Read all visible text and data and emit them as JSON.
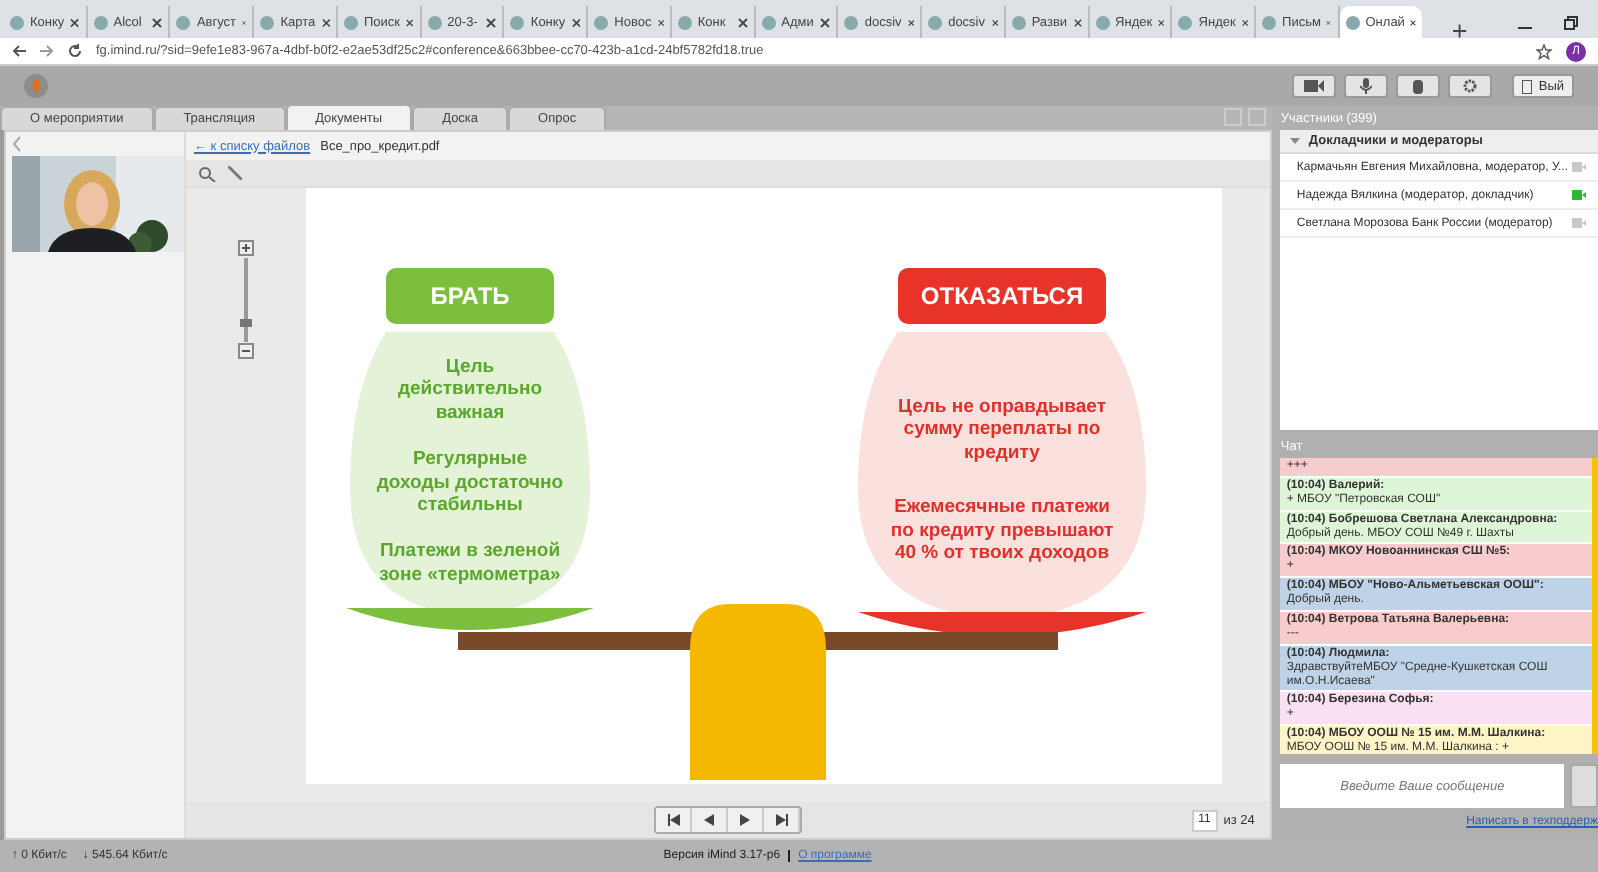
{
  "browser": {
    "tabs": [
      {
        "title": "Конку",
        "selected": false
      },
      {
        "title": "Alcol",
        "selected": false
      },
      {
        "title": "Август",
        "selected": false
      },
      {
        "title": "Карта",
        "selected": false
      },
      {
        "title": "Поиск",
        "selected": false
      },
      {
        "title": "20-3-",
        "selected": false
      },
      {
        "title": "Конку",
        "selected": false
      },
      {
        "title": "Новос",
        "selected": false
      },
      {
        "title": "Конк",
        "selected": false
      },
      {
        "title": "Адми",
        "selected": false
      },
      {
        "title": "docsiv",
        "selected": false
      },
      {
        "title": "docsiv",
        "selected": false
      },
      {
        "title": "Разви",
        "selected": false
      },
      {
        "title": "Яндек",
        "selected": false
      },
      {
        "title": "Яндек",
        "selected": false
      },
      {
        "title": "Письм",
        "selected": false
      },
      {
        "title": "Онлай",
        "selected": true
      }
    ],
    "url": "fg.imind.ru/?sid=9efe1e83-967a-4dbf-b0f2-e2ae53df25c2#conference&663bbee-cc70-423b-a1cd-24bf5782fd18.true",
    "profile_initial": "Л"
  },
  "header": {
    "exit_label": "Вый"
  },
  "tabs": [
    {
      "label": "О мероприятии",
      "selected": false
    },
    {
      "label": "Трансляция",
      "selected": false
    },
    {
      "label": "Документы",
      "selected": true
    },
    {
      "label": "Доска",
      "selected": false
    },
    {
      "label": "Опрос",
      "selected": false
    }
  ],
  "document": {
    "back_link": "← к списку файлов",
    "file_name": "Все_про_кредит.pdf",
    "page": "11",
    "page_total": "из 24",
    "zoom": {
      "level": 0.25
    }
  },
  "slide": {
    "left": {
      "title": "БРАТЬ",
      "lines": [
        "Цель действительно важная",
        "Регулярные доходы достаточно стабильны",
        "Платежи в зеленой зоне «термометра»"
      ]
    },
    "right": {
      "title": "ОТКАЗАТЬСЯ",
      "lines": [
        "Цель не оправдывает сумму переплаты по кредиту",
        "Ежемесячные платежи по кредиту превышают 40 % от твоих доходов"
      ]
    }
  },
  "participants": {
    "title": "Участники (399)",
    "group": "Докладчики и модераторы",
    "expanded": true,
    "items": [
      {
        "name": "Кармачьян Евгения Михайловна, модератор, У...",
        "camera_on": false
      },
      {
        "name": "Надежда Вялкина (модератор, докладчик)",
        "camera_on": true
      },
      {
        "name": "Светлана Морозова Банк России (модератор)",
        "camera_on": false
      }
    ]
  },
  "chat": {
    "title": "Чат",
    "placeholder": "Введите Ваше сообщение",
    "support_link": "Написать в техподдерж",
    "messages": [
      {
        "text": "+++",
        "color": "#f8cccc"
      },
      {
        "author": "(10:04) Валерий:",
        "text": "+ МБОУ \"Петровская СОШ\"",
        "color": "#dff5d8"
      },
      {
        "author": "(10:04) Бобрешова Светлана Александровна:",
        "text": "Добрый день. МБОУ СОШ №49 г. Шахты",
        "color": "#dff5d8"
      },
      {
        "author": "(10:04) МКОУ Новоаннинская СШ №5:",
        "text": "+",
        "color": "#f8cccc"
      },
      {
        "author": "(10:04) МБОУ \"Ново-Альметьевская ООШ\":",
        "text": "Добрый день.",
        "color": "#bfd3e8"
      },
      {
        "author": "(10:04) Ветрова Татьяна Валерьевна:",
        "text": "---",
        "color": "#f8cccc"
      },
      {
        "author": "(10:04) Людмила:",
        "text": "ЗдравствуйтеМБОУ \"Средне-Кушкетская СОШ им.О.Н.Исаева\"",
        "color": "#bfd3e8"
      },
      {
        "author": "(10:04) Березина Софья:",
        "text": "+",
        "color": "#fbe0f3"
      },
      {
        "author": "(10:04) МБОУ ООШ № 15 им. М.М. Шалкина:",
        "text": "МБОУ ООШ № 15 им. М.М. Шалкина : +",
        "color": "#fdf5c8"
      }
    ]
  },
  "footer": {
    "upload": "↑ 0 Кбит/с",
    "download": "↓ 545.64 Кбит/с",
    "version": "Версия iMind 3.17-p6",
    "about": "О программе"
  }
}
